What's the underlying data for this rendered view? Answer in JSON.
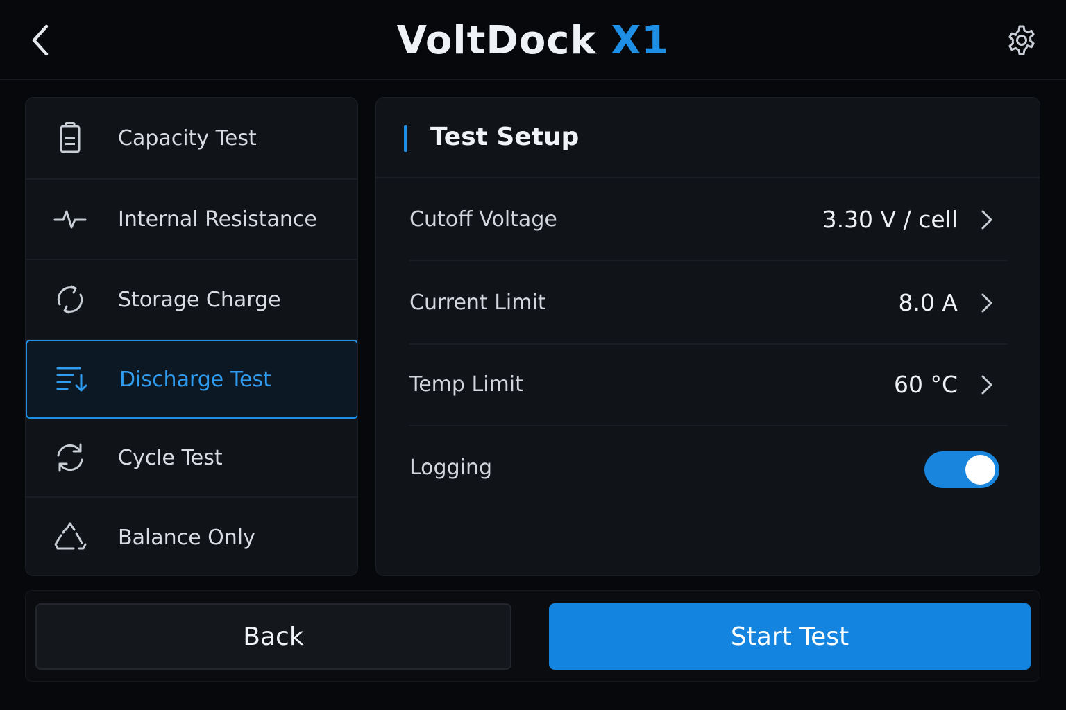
{
  "header": {
    "title_main": "VoltDock",
    "title_accent": "X1",
    "back_icon": "chevron-left-icon",
    "settings_icon": "gear-icon"
  },
  "colors": {
    "accent": "#1e8fe4",
    "background": "#06080b",
    "panel": "#101317"
  },
  "menu": {
    "items": [
      {
        "label": "Capacity Test",
        "icon": "battery-icon"
      },
      {
        "label": "Internal Resistance",
        "icon": "pulse-icon"
      },
      {
        "label": "Storage Charge",
        "icon": "circular-arrows-icon"
      },
      {
        "label": "Discharge Test",
        "icon": "list-down-arrow-icon",
        "selected": true
      },
      {
        "label": "Cycle Test",
        "icon": "refresh-icon"
      },
      {
        "label": "Balance Only",
        "icon": "triangle-recycle-icon"
      }
    ]
  },
  "panel": {
    "title": "Test Setup",
    "settings": [
      {
        "label": "Cutoff Voltage",
        "value": "3.30 V / cell"
      },
      {
        "label": "Current Limit",
        "value": "8.0 A"
      },
      {
        "label": "Temp Limit",
        "value": "60 °C"
      },
      {
        "label": "Logging",
        "toggle_on": true
      }
    ]
  },
  "footer": {
    "back_label": "Back",
    "start_label": "Start Test"
  }
}
